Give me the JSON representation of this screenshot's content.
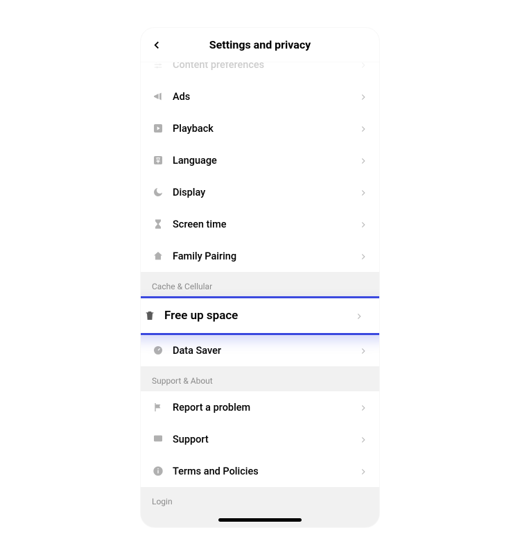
{
  "header": {
    "title": "Settings and privacy"
  },
  "partial_top_item": {
    "label": "Content preferences"
  },
  "top_items": [
    {
      "key": "ads",
      "label": "Ads",
      "icon": "megaphone"
    },
    {
      "key": "playback",
      "label": "Playback",
      "icon": "play"
    },
    {
      "key": "language",
      "label": "Language",
      "icon": "language"
    },
    {
      "key": "display",
      "label": "Display",
      "icon": "moon"
    },
    {
      "key": "screen-time",
      "label": "Screen time",
      "icon": "hourglass"
    },
    {
      "key": "family-pairing",
      "label": "Family Pairing",
      "icon": "home"
    }
  ],
  "sections": [
    {
      "key": "cache",
      "title": "Cache & Cellular",
      "items": [
        {
          "key": "free-up-space",
          "label": "Free up space",
          "icon": "trash",
          "highlighted": true
        },
        {
          "key": "data-saver",
          "label": "Data Saver",
          "icon": "gauge"
        }
      ]
    },
    {
      "key": "support",
      "title": "Support & About",
      "items": [
        {
          "key": "report-problem",
          "label": "Report a problem",
          "icon": "flag"
        },
        {
          "key": "support",
          "label": "Support",
          "icon": "chat"
        },
        {
          "key": "terms",
          "label": "Terms and Policies",
          "icon": "info"
        }
      ]
    }
  ],
  "login_section": {
    "title": "Login"
  }
}
